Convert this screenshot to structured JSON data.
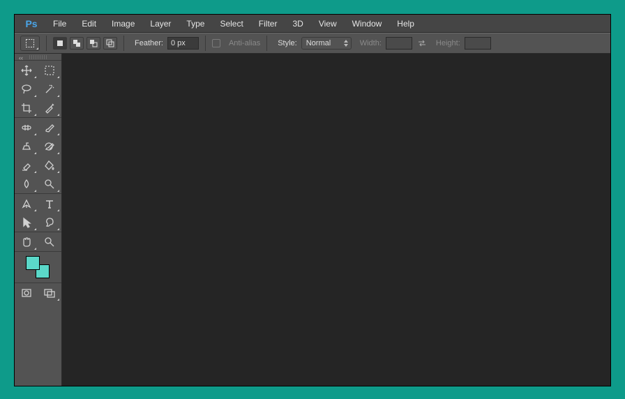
{
  "app": {
    "name": "Ps"
  },
  "menu": [
    "File",
    "Edit",
    "Image",
    "Layer",
    "Type",
    "Select",
    "Filter",
    "3D",
    "View",
    "Window",
    "Help"
  ],
  "options": {
    "feather_label": "Feather:",
    "feather_value": "0 px",
    "antialias_label": "Anti-alias",
    "style_label": "Style:",
    "style_value": "Normal",
    "width_label": "Width:",
    "height_label": "Height:"
  },
  "colors": {
    "fg": "#5bd8c9",
    "bg": "#5bd8c9"
  }
}
